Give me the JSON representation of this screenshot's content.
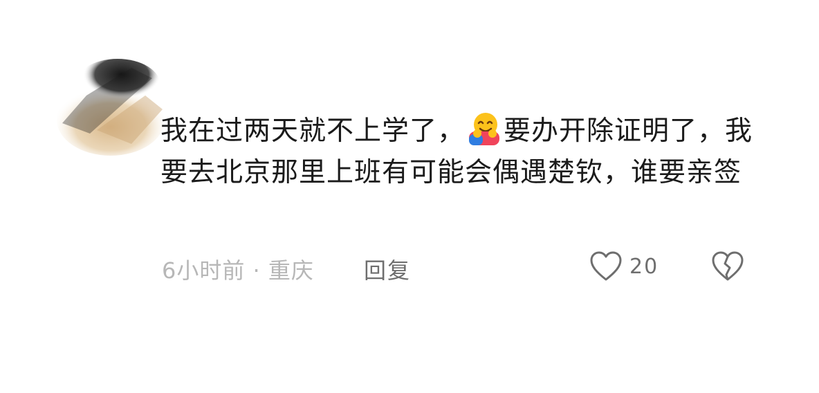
{
  "comment": {
    "text_line1_a": "我在过两天就不上学了，",
    "emoji": "hugging-face-emoji",
    "text_line1_b": "要办开除证明了，我要去北京那里上班有可能会偶遇楚钦，谁要亲签"
  },
  "meta": {
    "time_location": "6小时前 · 重庆",
    "reply_label": "回复",
    "like_count": "20"
  },
  "colors": {
    "text": "#1b1b1b",
    "meta": "#b7b7b7",
    "action": "#6e6e6e"
  }
}
